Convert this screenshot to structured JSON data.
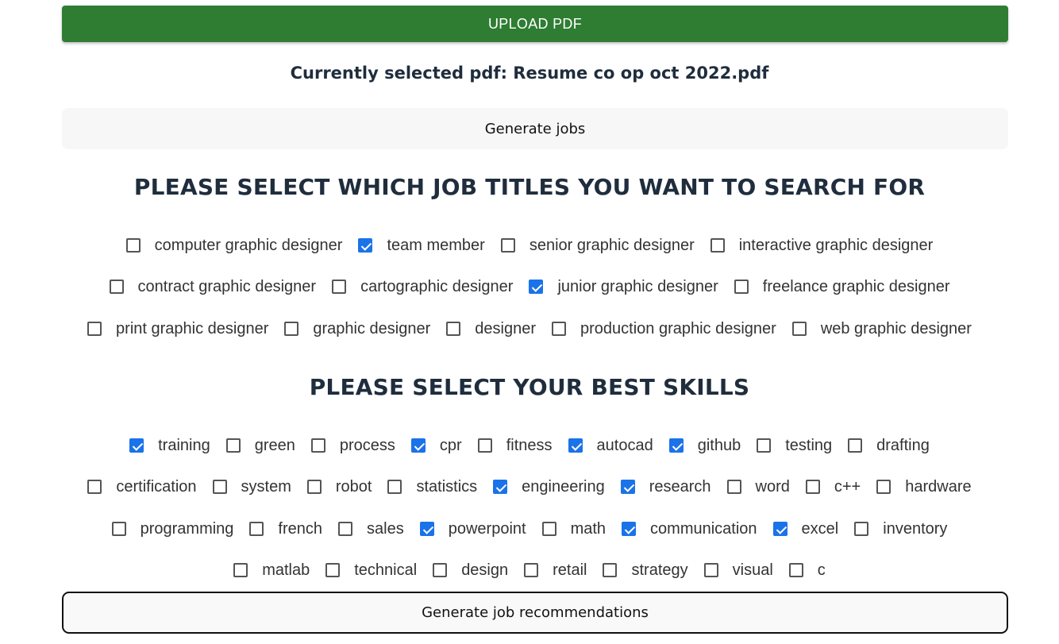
{
  "upload": {
    "label": "UPLOAD PDF"
  },
  "selected_pdf": {
    "text": "Currently selected pdf: Resume co op oct 2022.pdf"
  },
  "generate_jobs": {
    "label": "Generate jobs"
  },
  "job_titles": {
    "heading": "PLEASE SELECT WHICH JOB TITLES YOU WANT TO SEARCH FOR",
    "rows": [
      [
        {
          "label": "computer graphic designer",
          "checked": false
        },
        {
          "label": "team member",
          "checked": true
        },
        {
          "label": "senior graphic designer",
          "checked": false
        },
        {
          "label": "interactive graphic designer",
          "checked": false
        }
      ],
      [
        {
          "label": "contract graphic designer",
          "checked": false
        },
        {
          "label": "cartographic designer",
          "checked": false
        },
        {
          "label": "junior graphic designer",
          "checked": true
        },
        {
          "label": "freelance graphic designer",
          "checked": false
        }
      ],
      [
        {
          "label": "print graphic designer",
          "checked": false
        },
        {
          "label": "graphic designer",
          "checked": false
        },
        {
          "label": "designer",
          "checked": false
        },
        {
          "label": "production graphic designer",
          "checked": false
        },
        {
          "label": "web graphic designer",
          "checked": false
        }
      ]
    ]
  },
  "skills": {
    "heading": "PLEASE SELECT YOUR BEST SKILLS",
    "rows": [
      [
        {
          "label": "training",
          "checked": true
        },
        {
          "label": "green",
          "checked": false
        },
        {
          "label": "process",
          "checked": false
        },
        {
          "label": "cpr",
          "checked": true
        },
        {
          "label": "fitness",
          "checked": false
        },
        {
          "label": "autocad",
          "checked": true
        },
        {
          "label": "github",
          "checked": true
        },
        {
          "label": "testing",
          "checked": false
        },
        {
          "label": "drafting",
          "checked": false
        }
      ],
      [
        {
          "label": "certification",
          "checked": false
        },
        {
          "label": "system",
          "checked": false
        },
        {
          "label": "robot",
          "checked": false
        },
        {
          "label": "statistics",
          "checked": false
        },
        {
          "label": "engineering",
          "checked": true
        },
        {
          "label": "research",
          "checked": true
        },
        {
          "label": "word",
          "checked": false
        },
        {
          "label": "c++",
          "checked": false
        },
        {
          "label": "hardware",
          "checked": false
        }
      ],
      [
        {
          "label": "programming",
          "checked": false
        },
        {
          "label": "french",
          "checked": false
        },
        {
          "label": "sales",
          "checked": false
        },
        {
          "label": "powerpoint",
          "checked": true
        },
        {
          "label": "math",
          "checked": false
        },
        {
          "label": "communication",
          "checked": true
        },
        {
          "label": "excel",
          "checked": true
        },
        {
          "label": "inventory",
          "checked": false
        }
      ],
      [
        {
          "label": "matlab",
          "checked": false
        },
        {
          "label": "technical",
          "checked": false
        },
        {
          "label": "design",
          "checked": false
        },
        {
          "label": "retail",
          "checked": false
        },
        {
          "label": "strategy",
          "checked": false
        },
        {
          "label": "visual",
          "checked": false
        },
        {
          "label": "c",
          "checked": false
        }
      ]
    ]
  },
  "generate_recommendations": {
    "label": "Generate job recommendations"
  }
}
